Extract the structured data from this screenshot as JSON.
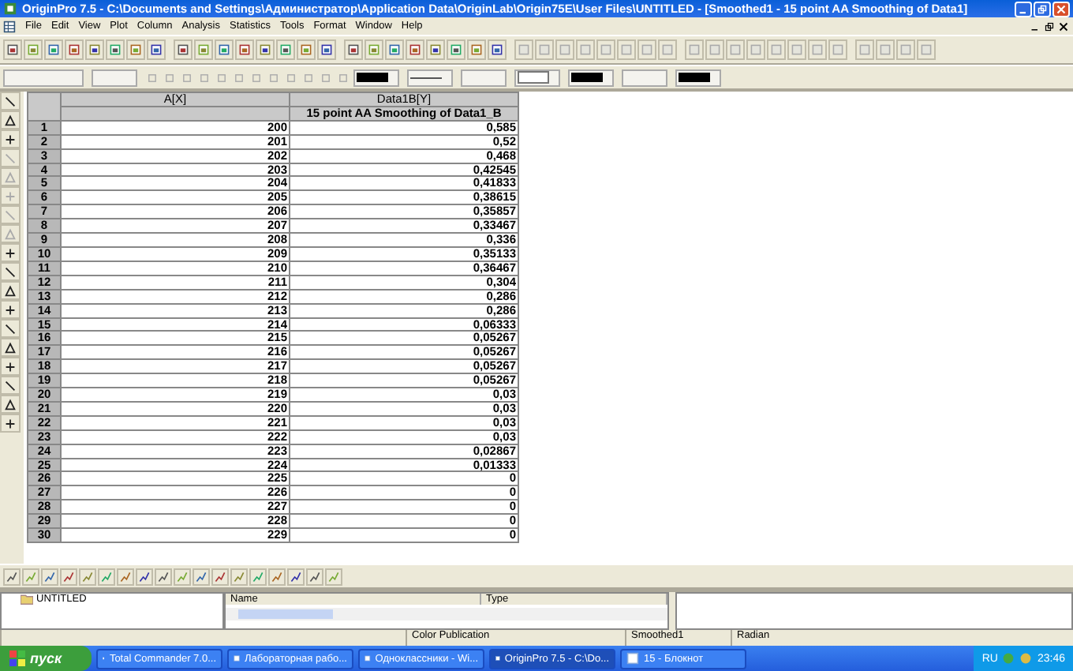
{
  "window": {
    "title": "OriginPro 7.5 - C:\\Documents and Settings\\Администратор\\Application Data\\OriginLab\\Origin75E\\User Files\\UNTITLED - [Smoothed1 - 15 point AA Smoothing of Data1]"
  },
  "menu": [
    "File",
    "Edit",
    "View",
    "Plot",
    "Column",
    "Analysis",
    "Statistics",
    "Tools",
    "Format",
    "Window",
    "Help"
  ],
  "worksheet": {
    "columns": [
      {
        "name": "A[X]"
      },
      {
        "name": "Data1B[Y]",
        "label": "15 point AA Smoothing of Data1_B"
      }
    ],
    "rows": [
      {
        "row": "1",
        "values": [
          "200",
          "0,585"
        ]
      },
      {
        "row": "2",
        "values": [
          "201",
          "0,52"
        ]
      },
      {
        "row": "3",
        "values": [
          "202",
          "0,468"
        ]
      },
      {
        "row": "4",
        "values": [
          "203",
          "0,42545"
        ]
      },
      {
        "row": "5",
        "values": [
          "204",
          "0,41833"
        ]
      },
      {
        "row": "6",
        "values": [
          "205",
          "0,38615"
        ]
      },
      {
        "row": "7",
        "values": [
          "206",
          "0,35857"
        ]
      },
      {
        "row": "8",
        "values": [
          "207",
          "0,33467"
        ]
      },
      {
        "row": "9",
        "values": [
          "208",
          "0,336"
        ]
      },
      {
        "row": "10",
        "values": [
          "209",
          "0,35133"
        ]
      },
      {
        "row": "11",
        "values": [
          "210",
          "0,36467"
        ]
      },
      {
        "row": "12",
        "values": [
          "211",
          "0,304"
        ]
      },
      {
        "row": "13",
        "values": [
          "212",
          "0,286"
        ]
      },
      {
        "row": "14",
        "values": [
          "213",
          "0,286"
        ]
      },
      {
        "row": "15",
        "values": [
          "214",
          "0,06333"
        ]
      },
      {
        "row": "16",
        "values": [
          "215",
          "0,05267"
        ]
      },
      {
        "row": "17",
        "values": [
          "216",
          "0,05267"
        ]
      },
      {
        "row": "18",
        "values": [
          "217",
          "0,05267"
        ]
      },
      {
        "row": "19",
        "values": [
          "218",
          "0,05267"
        ]
      },
      {
        "row": "20",
        "values": [
          "219",
          "0,03"
        ]
      },
      {
        "row": "21",
        "values": [
          "220",
          "0,03"
        ]
      },
      {
        "row": "22",
        "values": [
          "221",
          "0,03"
        ]
      },
      {
        "row": "23",
        "values": [
          "222",
          "0,03"
        ]
      },
      {
        "row": "24",
        "values": [
          "223",
          "0,02867"
        ]
      },
      {
        "row": "25",
        "values": [
          "224",
          "0,01333"
        ]
      },
      {
        "row": "26",
        "values": [
          "225",
          "0"
        ]
      },
      {
        "row": "27",
        "values": [
          "226",
          "0"
        ]
      },
      {
        "row": "28",
        "values": [
          "227",
          "0"
        ]
      },
      {
        "row": "29",
        "values": [
          "228",
          "0"
        ]
      },
      {
        "row": "30",
        "values": [
          "229",
          "0"
        ]
      }
    ]
  },
  "project_explorer": {
    "folder": "UNTITLED",
    "columns": [
      "Name",
      "Type"
    ]
  },
  "status_bar": [
    "Color Publication",
    "Smoothed1",
    "Radian"
  ],
  "taskbar": {
    "start": "пуск",
    "tasks": [
      {
        "label": "Total Commander 7.0...",
        "selected": false
      },
      {
        "label": "Лабораторная рабо...",
        "selected": false
      },
      {
        "label": "Одноклассники - Wi...",
        "selected": false
      },
      {
        "label": "OriginPro 7.5 - C:\\Do...",
        "selected": true
      },
      {
        "label": "15 - Блокнот",
        "selected": false
      }
    ],
    "language": "RU",
    "clock": "23:46"
  }
}
